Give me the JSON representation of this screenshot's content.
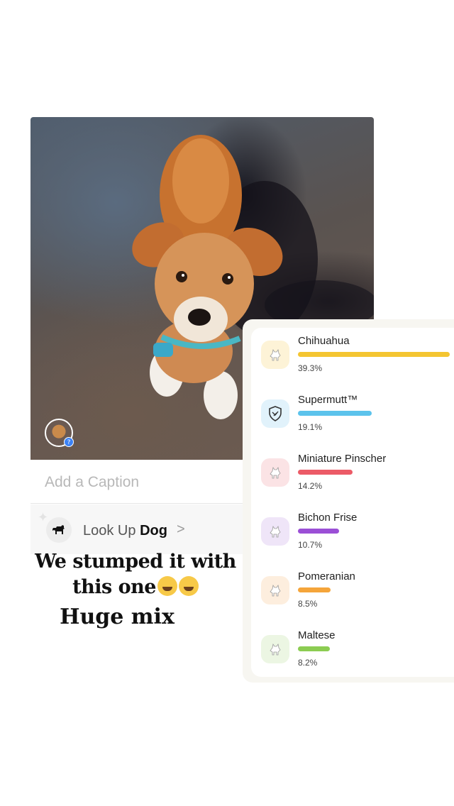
{
  "post": {
    "caption_placeholder": "Add a Caption",
    "avatar_badge": "?",
    "lookup": {
      "prefix": "Look Up",
      "subject": "Dog",
      "chevron": ">"
    }
  },
  "overlay": {
    "line1": "We stumped it with",
    "line2": "this one",
    "line3": "Huge mix"
  },
  "breeds": [
    {
      "name": "Chihuahua",
      "percent": "39.3%",
      "value": 39.3,
      "color": "#f4c531",
      "icon_bg": "#fdf3d7",
      "icon": "chihuahua-icon"
    },
    {
      "name": "Supermutt™",
      "percent": "19.1%",
      "value": 19.1,
      "color": "#5cc3ec",
      "icon_bg": "#e1f2fb",
      "icon": "supermutt-shield-icon"
    },
    {
      "name": "Miniature Pinscher",
      "percent": "14.2%",
      "value": 14.2,
      "color": "#ec5b67",
      "icon_bg": "#fbe3e5",
      "icon": "miniature-pinscher-icon"
    },
    {
      "name": "Bichon Frise",
      "percent": "10.7%",
      "value": 10.7,
      "color": "#9b4fd6",
      "icon_bg": "#efe5f8",
      "icon": "bichon-frise-icon"
    },
    {
      "name": "Pomeranian",
      "percent": "8.5%",
      "value": 8.5,
      "color": "#f5a53a",
      "icon_bg": "#fdeede",
      "icon": "pomeranian-icon"
    },
    {
      "name": "Maltese",
      "percent": "8.2%",
      "value": 8.2,
      "color": "#8ccc52",
      "icon_bg": "#ecf6e3",
      "icon": "maltese-icon"
    }
  ]
}
